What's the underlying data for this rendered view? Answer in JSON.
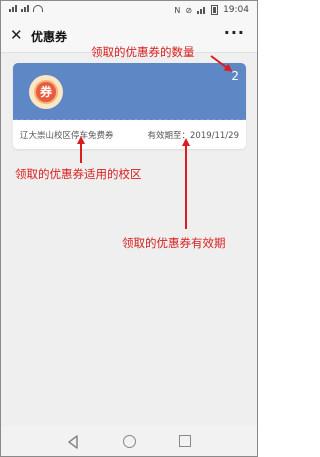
{
  "status_bar": {
    "time": "19:04",
    "icons": [
      "sim-signal-icon",
      "sim-signal-icon",
      "wifi-icon",
      "nfc-icon",
      "mute-icon",
      "signal-icon",
      "battery-icon"
    ]
  },
  "header": {
    "close_icon": "close-icon",
    "title": "优惠券",
    "more_label": "···"
  },
  "coupon": {
    "badge_text": "券",
    "count": "2",
    "name": "辽大崇山校区停车免费券",
    "expire_label": "有效期至：",
    "expire_date": "2019/11/29",
    "colors": {
      "header_bg": "#5e87c6",
      "badge_bg": "#e85b3c"
    }
  },
  "annotations": {
    "count_note": "领取的优惠券的数量",
    "campus_note": "领取的优惠券适用的校区",
    "expire_note": "领取的优惠券有效期",
    "color": "#d81e1e"
  },
  "nav_bar": {
    "icons": [
      "back-icon",
      "home-icon",
      "recent-apps-icon"
    ]
  }
}
